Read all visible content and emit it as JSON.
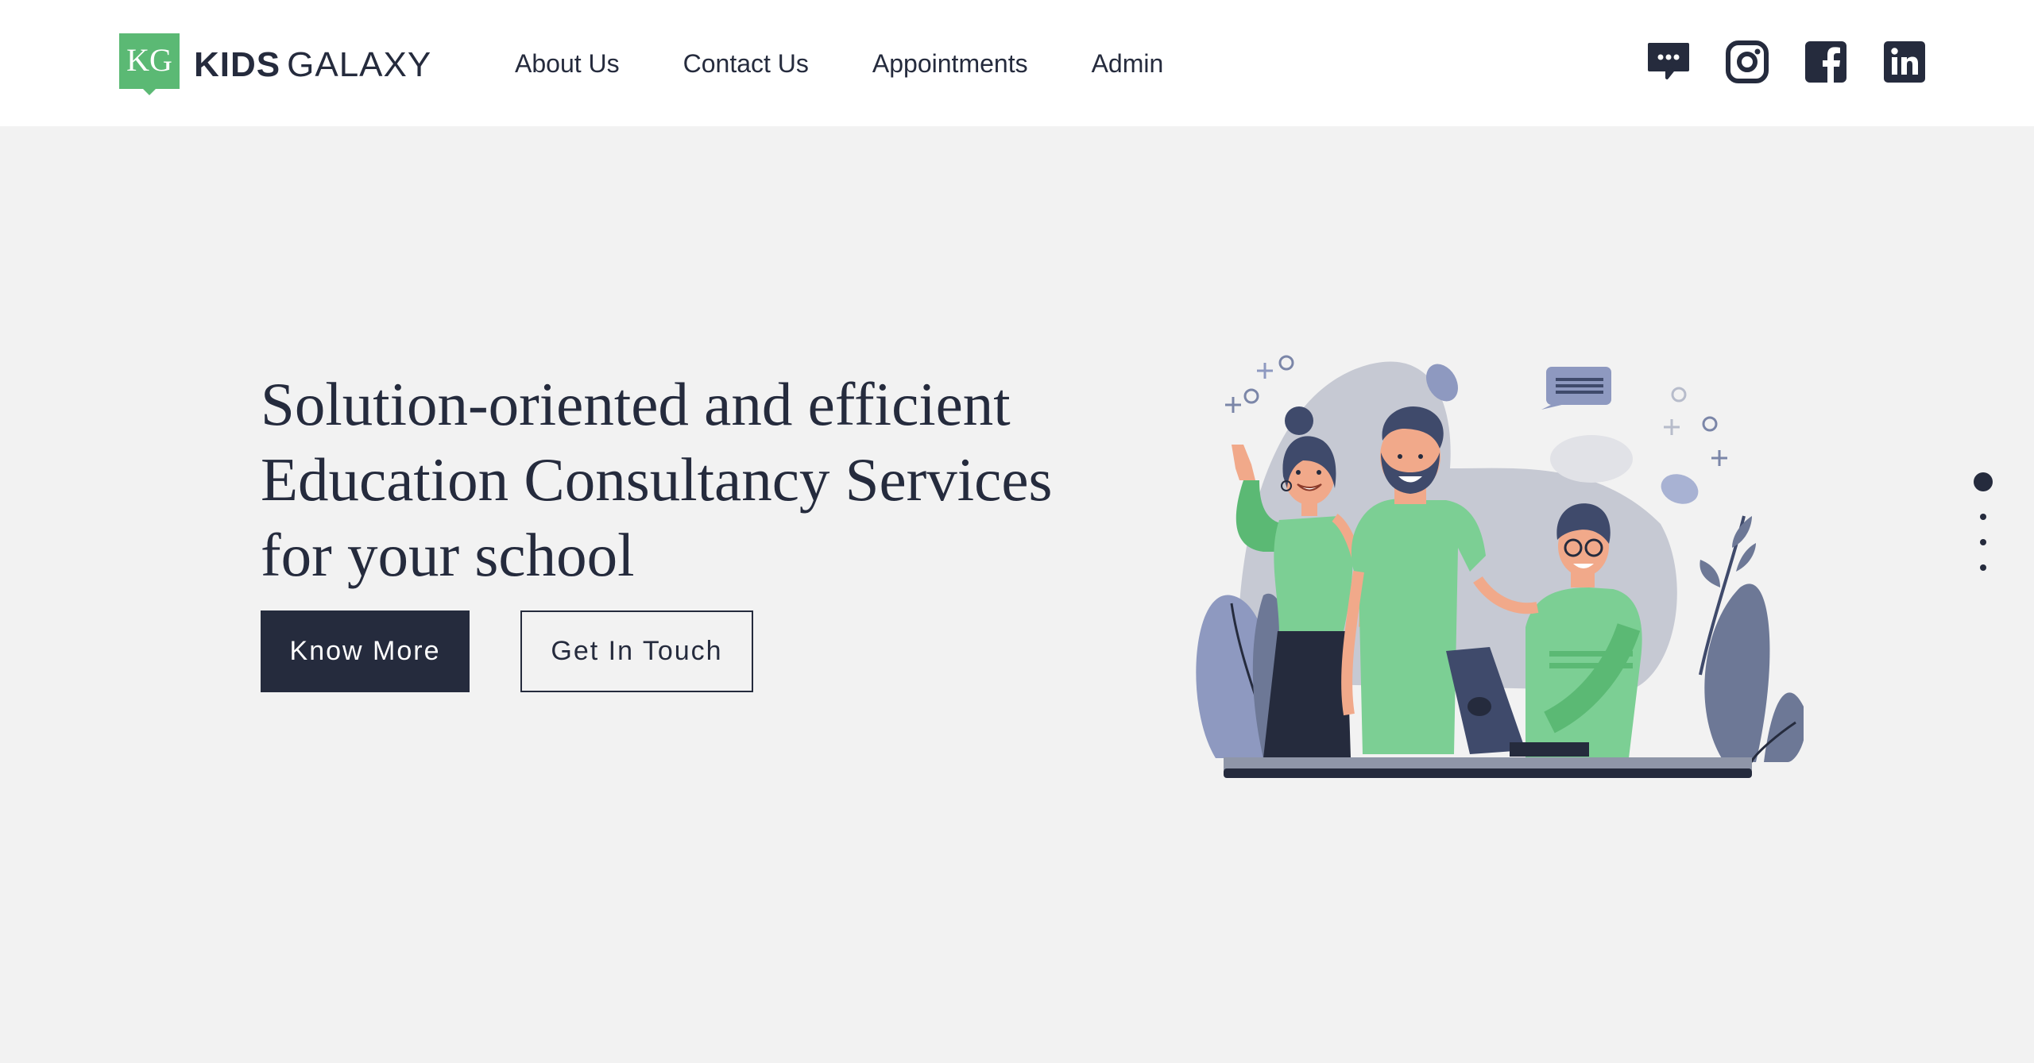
{
  "brand": {
    "mark_text": "KG",
    "name_bold": "KIDS",
    "name_light": "GALAXY",
    "mark_color": "#5bb974"
  },
  "nav": {
    "items": [
      {
        "label": "About Us"
      },
      {
        "label": "Contact Us"
      },
      {
        "label": "Appointments"
      },
      {
        "label": "Admin"
      }
    ]
  },
  "social": {
    "icons": [
      "chat-icon",
      "instagram-icon",
      "facebook-icon",
      "linkedin-icon"
    ],
    "color": "#252b3d"
  },
  "hero": {
    "title_lines": [
      "Solution-oriented and efficient",
      "Education Consultancy Services",
      "for your school"
    ],
    "primary_button": "Know More",
    "secondary_button": "Get In Touch"
  },
  "slider": {
    "slide_count": 4,
    "active_slide": 1
  },
  "colors": {
    "primary": "#252b3d",
    "accent_green": "#5bb974",
    "background": "#f2f2f2",
    "header_bg": "#ffffff"
  }
}
